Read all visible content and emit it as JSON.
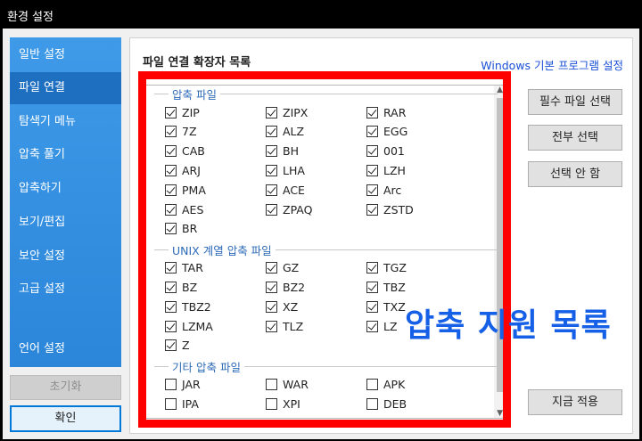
{
  "window": {
    "title": "환경 설정"
  },
  "sidebar": {
    "items": [
      {
        "label": "일반 설정"
      },
      {
        "label": "파일 연결"
      },
      {
        "label": "탐색기 메뉴"
      },
      {
        "label": "압축 풀기"
      },
      {
        "label": "압축하기"
      },
      {
        "label": "보기/편집"
      },
      {
        "label": "보안 설정"
      },
      {
        "label": "고급 설정"
      },
      {
        "label": "언어 설정"
      }
    ],
    "active_index": 1,
    "reset_label": "초기화",
    "ok_label": "확인"
  },
  "panel": {
    "title": "파일 연결 확장자 목록",
    "link": "Windows 기본 프로그램 설정",
    "buttons": {
      "required": "필수 파일 선택",
      "select_all": "전부 선택",
      "select_none": "선택 안 함",
      "apply_now": "지금 적용"
    }
  },
  "groups": [
    {
      "header": "압축 파일",
      "items": [
        {
          "label": "ZIP",
          "checked": true
        },
        {
          "label": "ZIPX",
          "checked": true
        },
        {
          "label": "RAR",
          "checked": true
        },
        {
          "label": "7Z",
          "checked": true
        },
        {
          "label": "ALZ",
          "checked": true
        },
        {
          "label": "EGG",
          "checked": true
        },
        {
          "label": "CAB",
          "checked": true
        },
        {
          "label": "BH",
          "checked": true
        },
        {
          "label": "001",
          "checked": true
        },
        {
          "label": "ARJ",
          "checked": true
        },
        {
          "label": "LHA",
          "checked": true
        },
        {
          "label": "LZH",
          "checked": true
        },
        {
          "label": "PMA",
          "checked": true
        },
        {
          "label": "ACE",
          "checked": true
        },
        {
          "label": "Arc",
          "checked": true
        },
        {
          "label": "AES",
          "checked": true
        },
        {
          "label": "ZPAQ",
          "checked": true
        },
        {
          "label": "ZSTD",
          "checked": true
        },
        {
          "label": "BR",
          "checked": true
        }
      ]
    },
    {
      "header": "UNIX 계열 압축 파일",
      "items": [
        {
          "label": "TAR",
          "checked": true
        },
        {
          "label": "GZ",
          "checked": true
        },
        {
          "label": "TGZ",
          "checked": true
        },
        {
          "label": "BZ",
          "checked": true
        },
        {
          "label": "BZ2",
          "checked": true
        },
        {
          "label": "TBZ",
          "checked": true
        },
        {
          "label": "TBZ2",
          "checked": true
        },
        {
          "label": "XZ",
          "checked": true
        },
        {
          "label": "TXZ",
          "checked": true
        },
        {
          "label": "LZMA",
          "checked": true
        },
        {
          "label": "TLZ",
          "checked": true
        },
        {
          "label": "LZ",
          "checked": true
        },
        {
          "label": "Z",
          "checked": true
        }
      ]
    },
    {
      "header": "기타 압축 파일",
      "items": [
        {
          "label": "JAR",
          "checked": false
        },
        {
          "label": "WAR",
          "checked": false
        },
        {
          "label": "APK",
          "checked": false
        },
        {
          "label": "IPA",
          "checked": false
        },
        {
          "label": "XPI",
          "checked": false
        },
        {
          "label": "DEB",
          "checked": false
        }
      ]
    }
  ],
  "annotation": {
    "text": "압축 지원 목록",
    "color": "#1560e6",
    "box_color": "#ff0000"
  }
}
